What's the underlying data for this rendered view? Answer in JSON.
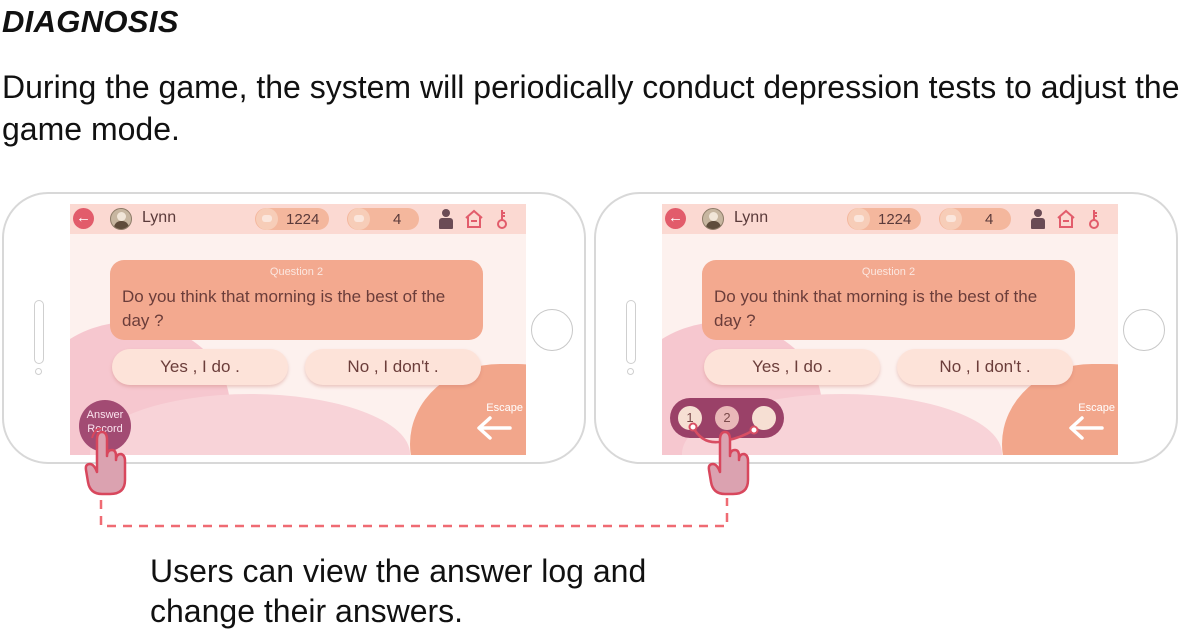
{
  "heading": "DIAGNOSIS",
  "description": "During the game, the system will periodically conduct depression tests to adjust the game mode.",
  "screens": [
    {
      "username": "Lynn",
      "coins": "1224",
      "cards": "4",
      "question_number": "Question 2",
      "question_text": "Do you think that morning is the best of the day ?",
      "answer_yes": "Yes , I do .",
      "answer_no": "No , I don't .",
      "escape_label": "Escape",
      "answer_record_label": "Answer Record"
    },
    {
      "username": "Lynn",
      "coins": "1224",
      "cards": "4",
      "question_number": "Question 2",
      "question_text": "Do you think that morning is the best of the day ?",
      "answer_yes": "Yes , I do .",
      "answer_no": "No , I don't .",
      "escape_label": "Escape",
      "log_items": [
        "1",
        "2",
        ""
      ]
    }
  ],
  "caption": "Users can view the answer log and change their answers.",
  "colors": {
    "accent_red": "#e25c6b",
    "question_bg": "#f3a98f",
    "record_button": "#a24b73",
    "connector_line": "#ef6b73"
  },
  "icons": [
    "back-arrow-icon",
    "avatar-icon",
    "coin-icon",
    "card-icon",
    "person-icon",
    "house-icon",
    "key-icon",
    "escape-arrow-icon",
    "pointing-hand-icon"
  ]
}
